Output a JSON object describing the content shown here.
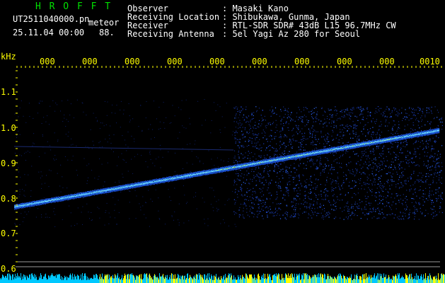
{
  "header": {
    "brand": "H R O F F T",
    "filename": "UT2511040000.pn",
    "meteor_label": "meteor",
    "datetime": "25.11.04 00:00",
    "count": "88.",
    "fields": [
      {
        "label": "Observer",
        "value": ": Masaki Kano"
      },
      {
        "label": "Receiving Location",
        "value": ": Shibukawa, Gunma, Japan"
      },
      {
        "label": "Receiver",
        "value": ": RTL-SDR SDR# 43dB L15 96.7MHz CW"
      },
      {
        "label": "Receiving Antenna",
        "value": ": 5el Yagi Az 280 for Seoul"
      }
    ]
  },
  "plot": {
    "y_unit": "kHz",
    "y_ticks": [
      "1.1",
      "1.0",
      "0.9",
      "0.8",
      "0.7",
      "0.6"
    ],
    "x_ticks": [
      "000",
      "000",
      "000",
      "000",
      "000",
      "000",
      "000",
      "000",
      "000",
      "0010"
    ]
  },
  "colors": {
    "background": "#000000",
    "text": "#ffffff",
    "accent": "#ffff00",
    "brand": "#00e000",
    "trace": "#3aa0ff"
  }
}
